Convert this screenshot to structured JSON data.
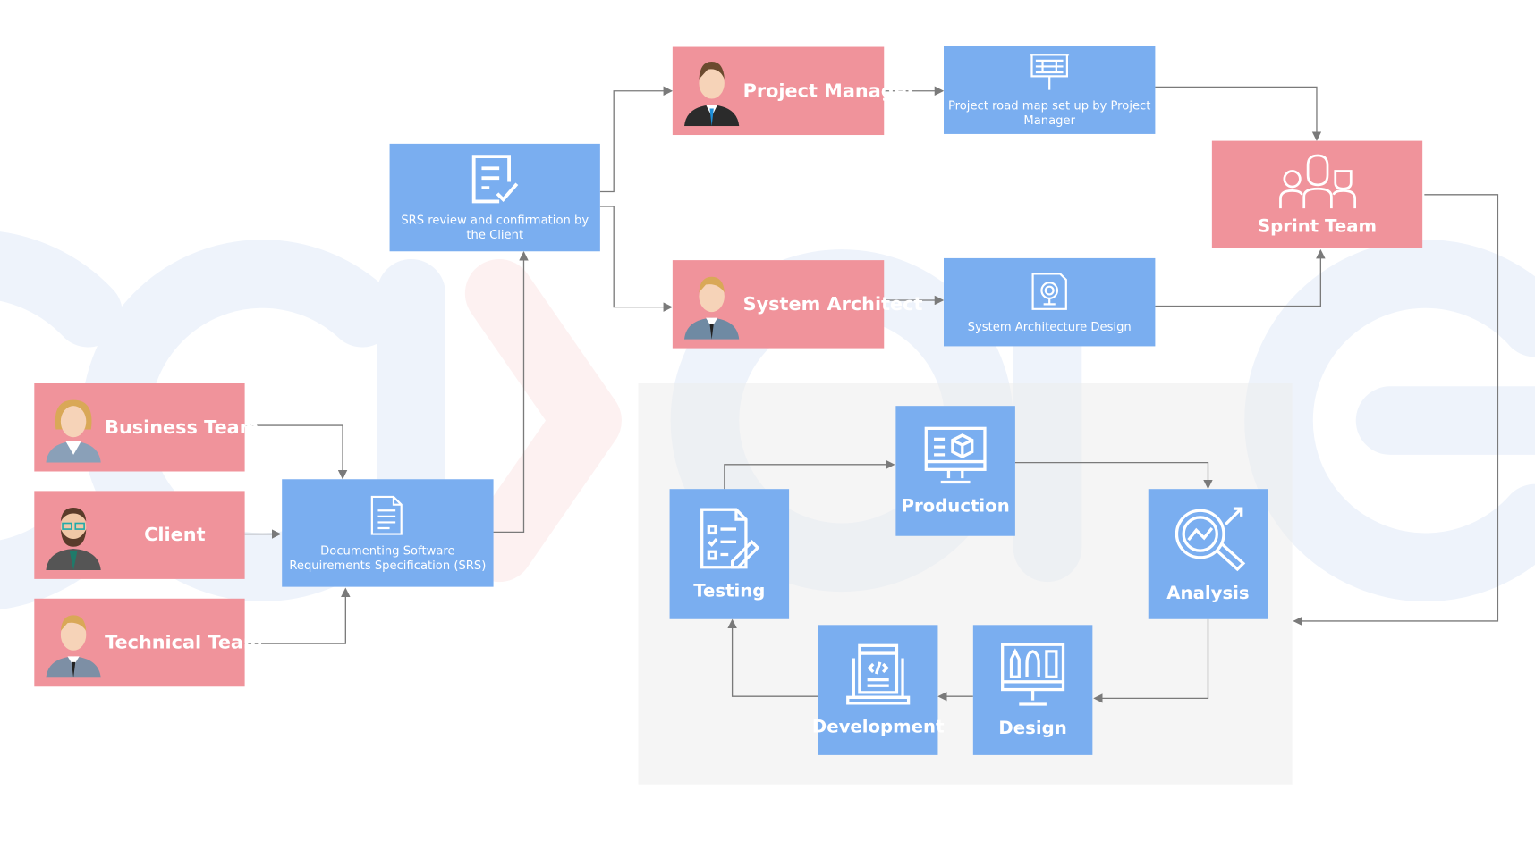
{
  "colors": {
    "role": "#f0939b",
    "process": "#7aaef0",
    "arrow": "#7a7a7a",
    "panel": "#f3f3f3"
  },
  "stakeholders": [
    {
      "label": "Business Team",
      "icon": "businesswoman-avatar"
    },
    {
      "label": "Client",
      "icon": "bearded-man-avatar"
    },
    {
      "label": "Technical Team",
      "icon": "businessman-avatar"
    }
  ],
  "srs_doc": {
    "label": "Documenting Software Requirements Specification (SRS)",
    "icon": "document-icon"
  },
  "srs_review": {
    "label": "SRS review and confirmation by the Client",
    "icon": "checklist-document-icon"
  },
  "project_manager": {
    "label": "Project Manager",
    "icon": "manager-avatar"
  },
  "system_architect": {
    "label": "System Architect",
    "icon": "architect-avatar"
  },
  "roadmap": {
    "label": "Project road map set up by Project Manager",
    "icon": "presentation-board-icon"
  },
  "architecture_design": {
    "label": "System Architecture Design",
    "icon": "blueprint-icon"
  },
  "sprint_team": {
    "label": "Sprint Team",
    "icon": "team-icon"
  },
  "cycle": [
    {
      "label": "Production",
      "icon": "monitor-cube-icon"
    },
    {
      "label": "Analysis",
      "icon": "magnifier-chart-icon"
    },
    {
      "label": "Design",
      "icon": "design-tools-monitor-icon"
    },
    {
      "label": "Development",
      "icon": "laptop-code-icon"
    },
    {
      "label": "Testing",
      "icon": "test-checklist-icon"
    }
  ]
}
